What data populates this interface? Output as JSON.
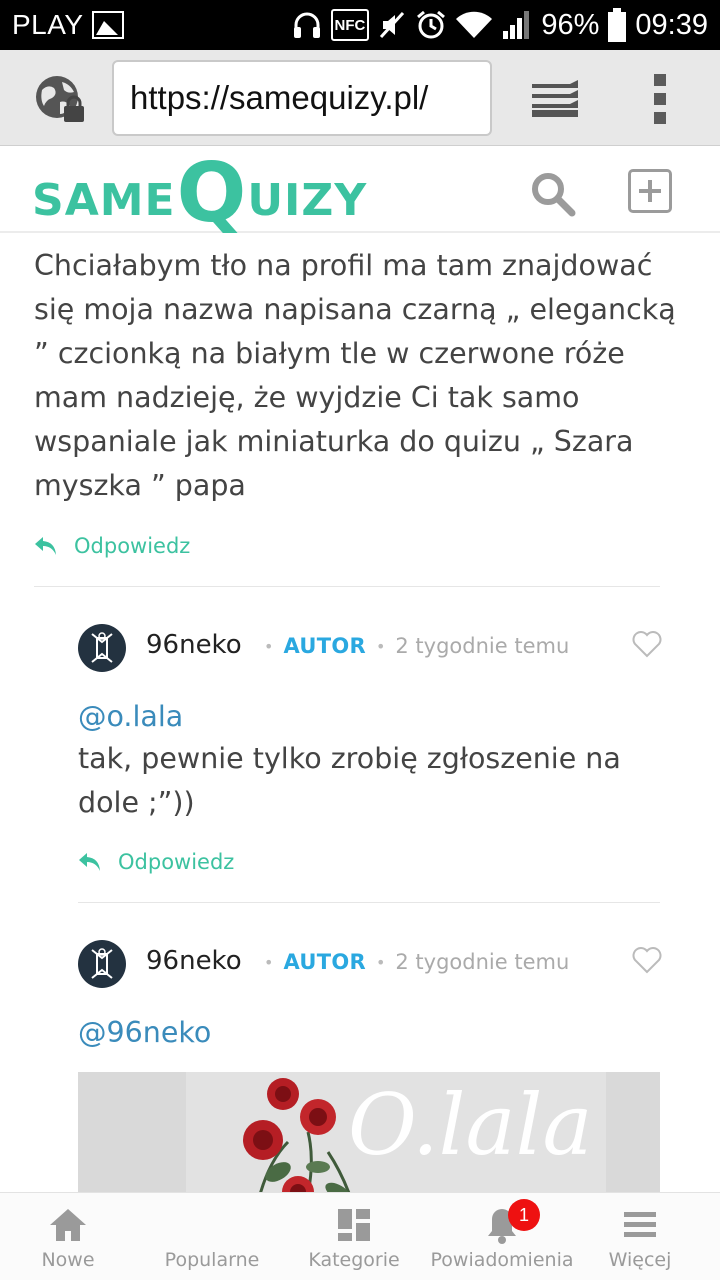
{
  "status_bar": {
    "carrier": "PLAY",
    "nfc_label": "NFC",
    "battery": "96%",
    "time": "09:39"
  },
  "browser": {
    "url": "https://samequizy.pl/"
  },
  "header": {
    "logo_same": "SAME",
    "logo_q": "Q",
    "logo_uizy": "UIZY"
  },
  "comment": {
    "text": "Chciałabym tło na profil ma tam znajdować się moja nazwa napisana czarną „ elegancką ” czcionką na białym tle w czerwone róże mam nadzieję, że wyjdzie Ci tak samo wspaniale jak miniaturka do quizu „ Szara myszka ” papa",
    "reply_label": "Odpowiedz"
  },
  "replies": [
    {
      "author": "96neko",
      "badge": "AUTOR",
      "time": "2 tygodnie temu",
      "mention": "@o.lala",
      "text": "tak, pewnie tylko zrobię zgłoszenie na dole ;”))",
      "reply_label": "Odpowiedz"
    },
    {
      "author": "96neko",
      "badge": "AUTOR",
      "time": "2 tygodnie temu",
      "mention": "@96neko",
      "image_text": "O.lala"
    }
  ],
  "bottom_nav": {
    "items": [
      {
        "label": "Nowe",
        "icon": "home-icon"
      },
      {
        "label": "Popularne",
        "icon": "star-icon"
      },
      {
        "label": "Kategorie",
        "icon": "grid-icon"
      },
      {
        "label": "Powiadomienia",
        "icon": "bell-icon",
        "count": "1"
      },
      {
        "label": "Więcej",
        "icon": "menu-icon"
      }
    ]
  },
  "colors": {
    "accent": "#3cc2a0",
    "author_badge": "#2aa8e0",
    "mention": "#3a8bbb",
    "notification": "#ee1111"
  }
}
